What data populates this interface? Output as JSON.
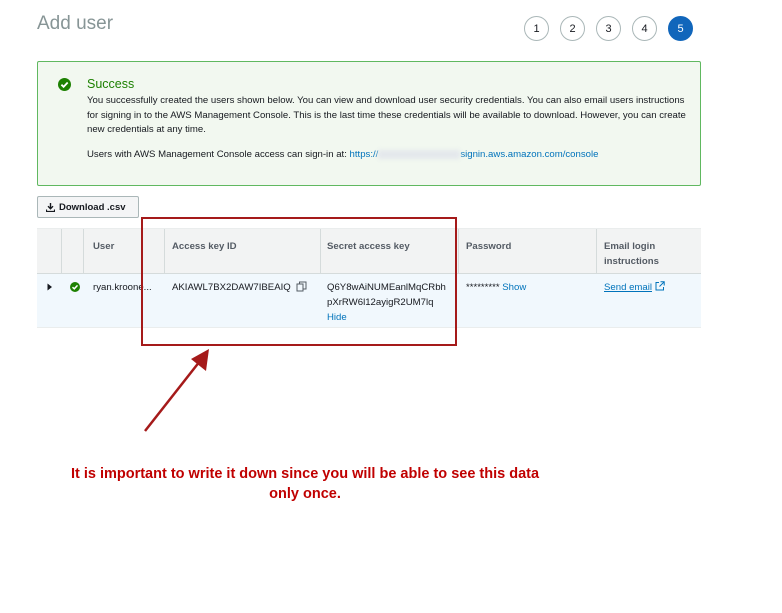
{
  "page": {
    "title": "Add user"
  },
  "steps": [
    "1",
    "2",
    "3",
    "4",
    "5"
  ],
  "alert": {
    "title": "Success",
    "body": "You successfully created the users shown below. You can view and download user security credentials. You can also email users instructions for signing in to the AWS Management Console. This is the last time these credentials will be available to download. However, you can create new credentials at any time.",
    "signin_prefix": "Users with AWS Management Console access can sign-in at: ",
    "signin_link_start": "https://",
    "signin_link_end": "signin.aws.amazon.com/console",
    "status_color": "#1d8102"
  },
  "toolbar": {
    "download_label": "Download .csv"
  },
  "table": {
    "headers": {
      "user": "User",
      "access_key_id": "Access key ID",
      "secret_access_key": "Secret access key",
      "password": "Password",
      "email_line1": "Email login",
      "email_line2": "instructions"
    },
    "row": {
      "user": "ryan.kroone...",
      "access_key_id": "AKIAWL7BX2DAW7IBEAIQ",
      "secret_line1": "Q6Y8wAiNUMEanlMqCRbh",
      "secret_line2": "pXrRW6l12ayigR2UM7lq",
      "secret_hide": "Hide",
      "password_mask": "*********",
      "password_show": "Show",
      "email_link": "Send email"
    }
  },
  "annotation": {
    "line1": "It is important to write it down since you will be able to see this data",
    "line2": "only once.",
    "color": "#c00000"
  }
}
